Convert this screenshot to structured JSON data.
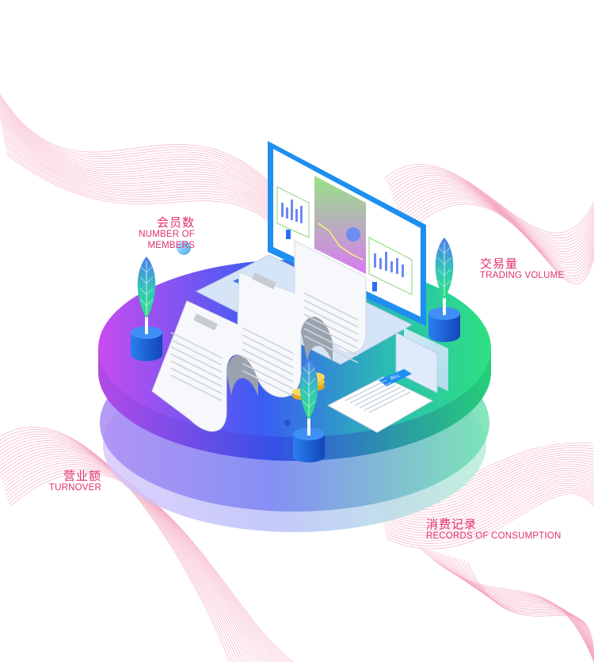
{
  "labels": {
    "members": {
      "cn": "会员数",
      "en": "NUMBER OF MEMBERS"
    },
    "trading": {
      "cn": "交易量",
      "en": "TRADING VOLUME"
    },
    "turnover": {
      "cn": "营业额",
      "en": "TURNOVER"
    },
    "consumption": {
      "cn": "消费记录",
      "en": "RECORDS OF CONSUMPTION"
    }
  },
  "bill_tag": "BILL",
  "colors": {
    "accent_text": "#e0306a",
    "wave_lines": "#f08aa8",
    "platform_left": "#c84cf0",
    "platform_mid": "#3a5cf2",
    "platform_right": "#2ee080",
    "screen_frame": "#1e8ff0",
    "leaf": "#3ad6a0",
    "pot": "#1a66d8",
    "coin": "#f4c838"
  }
}
